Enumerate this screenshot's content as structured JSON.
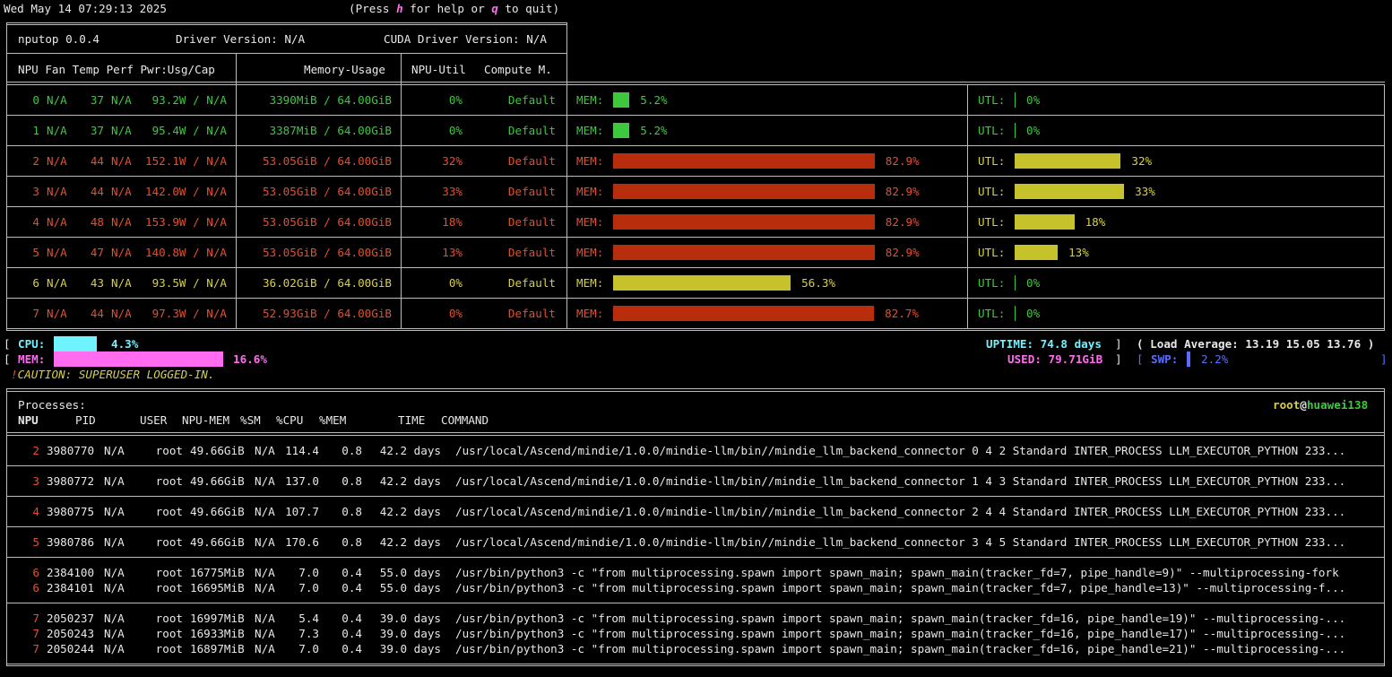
{
  "topbar": {
    "datetime": "Wed May 14 07:29:13 2025",
    "help_prefix": "(Press ",
    "help_key": "h",
    "help_mid": " for help or ",
    "quit_key": "q",
    "help_suffix": " to quit)"
  },
  "header": {
    "app": "nputop 0.0.4",
    "driver": "Driver Version: N/A",
    "cuda": "CUDA Driver Version: N/A",
    "col_left": "NPU Fan Temp Perf Pwr:Usg/Cap",
    "col_mem": "Memory-Usage",
    "col_util": "NPU-Util",
    "col_compute": "Compute M."
  },
  "npus": [
    {
      "id": "0",
      "fan": "N/A",
      "temp": "37",
      "perf": "N/A",
      "pwr": "93.2W / N/A",
      "mem": "3390MiB / 64.00GiB",
      "util": "0%",
      "compute": "Default",
      "mem_pct": 5.2,
      "mem_label": "5.2%",
      "util_pct": 0,
      "util_label": "0%",
      "color": "g",
      "mem_bar_color": "#3ec83e",
      "util_bar_color": "#3ec83e"
    },
    {
      "id": "1",
      "fan": "N/A",
      "temp": "37",
      "perf": "N/A",
      "pwr": "95.4W / N/A",
      "mem": "3387MiB / 64.00GiB",
      "util": "0%",
      "compute": "Default",
      "mem_pct": 5.2,
      "mem_label": "5.2%",
      "util_pct": 0,
      "util_label": "0%",
      "color": "g",
      "mem_bar_color": "#3ec83e",
      "util_bar_color": "#3ec83e"
    },
    {
      "id": "2",
      "fan": "N/A",
      "temp": "44",
      "perf": "N/A",
      "pwr": "152.1W / N/A",
      "mem": "53.05GiB / 64.00GiB",
      "util": "32%",
      "compute": "Default",
      "mem_pct": 82.9,
      "mem_label": "82.9%",
      "util_pct": 32,
      "util_label": "32%",
      "color": "r",
      "mem_bar_color": "#b82d0c",
      "util_bar_color": "#c6c22c"
    },
    {
      "id": "3",
      "fan": "N/A",
      "temp": "44",
      "perf": "N/A",
      "pwr": "142.0W / N/A",
      "mem": "53.05GiB / 64.00GiB",
      "util": "33%",
      "compute": "Default",
      "mem_pct": 82.9,
      "mem_label": "82.9%",
      "util_pct": 33,
      "util_label": "33%",
      "color": "r",
      "mem_bar_color": "#b82d0c",
      "util_bar_color": "#c6c22c"
    },
    {
      "id": "4",
      "fan": "N/A",
      "temp": "48",
      "perf": "N/A",
      "pwr": "153.9W / N/A",
      "mem": "53.05GiB / 64.00GiB",
      "util": "18%",
      "compute": "Default",
      "mem_pct": 82.9,
      "mem_label": "82.9%",
      "util_pct": 18,
      "util_label": "18%",
      "color": "r",
      "mem_bar_color": "#b82d0c",
      "util_bar_color": "#c6c22c"
    },
    {
      "id": "5",
      "fan": "N/A",
      "temp": "47",
      "perf": "N/A",
      "pwr": "140.8W / N/A",
      "mem": "53.05GiB / 64.00GiB",
      "util": "13%",
      "compute": "Default",
      "mem_pct": 82.9,
      "mem_label": "82.9%",
      "util_pct": 13,
      "util_label": "13%",
      "color": "r",
      "mem_bar_color": "#b82d0c",
      "util_bar_color": "#c6c22c"
    },
    {
      "id": "6",
      "fan": "N/A",
      "temp": "43",
      "perf": "N/A",
      "pwr": "93.5W / N/A",
      "mem": "36.02GiB / 64.00GiB",
      "util": "0%",
      "compute": "Default",
      "mem_pct": 56.3,
      "mem_label": "56.3%",
      "util_pct": 0,
      "util_label": "0%",
      "color": "y",
      "mem_bar_color": "#c6c22c",
      "util_bar_color": "#3ec83e"
    },
    {
      "id": "7",
      "fan": "N/A",
      "temp": "44",
      "perf": "N/A",
      "pwr": "97.3W / N/A",
      "mem": "52.93GiB / 64.00GiB",
      "util": "0%",
      "compute": "Default",
      "mem_pct": 82.7,
      "mem_label": "82.7%",
      "util_pct": 0,
      "util_label": "0%",
      "color": "r",
      "mem_bar_color": "#b82d0c",
      "util_bar_color": "#3ec83e"
    }
  ],
  "labels": {
    "mem": "MEM:",
    "utl": "UTL:"
  },
  "system": {
    "cpu_label": "CPU:",
    "cpu_pct": 4.3,
    "cpu_value": "4.3%",
    "mem_label": "MEM:",
    "mem_pct": 16.6,
    "mem_value": "16.6%",
    "uptime": "UPTIME: 74.8 days",
    "load": "( Load Average: 13.19 15.05 13.76 )",
    "used": "USED: 79.71GiB",
    "swp_label": "SWP:",
    "swp_pct": 2.2,
    "swp_value": "2.2%",
    "caution": "CAUTION: SUPERUSER LOGGED-IN."
  },
  "processes": {
    "title": "Processes:",
    "user": "root",
    "host": "huawei138",
    "columns": {
      "npu": "NPU",
      "pid": "PID",
      "user": "USER",
      "npumem": "NPU-MEM",
      "sm": "%SM",
      "cpu": "%CPU",
      "mem": "%MEM",
      "time": "TIME",
      "command": "COMMAND"
    },
    "rows": [
      {
        "npu": "2",
        "pid": "3980770",
        "x": "N/A",
        "user": "root",
        "npumem": "49.66GiB",
        "sm": "N/A",
        "cpu": "114.4",
        "mem": "0.8",
        "time": "42.2 days",
        "command": "/usr/local/Ascend/mindie/1.0.0/mindie-llm/bin//mindie_llm_backend_connector 0 4 2 Standard INTER_PROCESS LLM_EXECUTOR_PYTHON 233..."
      },
      {
        "npu": "3",
        "pid": "3980772",
        "x": "N/A",
        "user": "root",
        "npumem": "49.66GiB",
        "sm": "N/A",
        "cpu": "137.0",
        "mem": "0.8",
        "time": "42.2 days",
        "command": "/usr/local/Ascend/mindie/1.0.0/mindie-llm/bin//mindie_llm_backend_connector 1 4 3 Standard INTER_PROCESS LLM_EXECUTOR_PYTHON 233..."
      },
      {
        "npu": "4",
        "pid": "3980775",
        "x": "N/A",
        "user": "root",
        "npumem": "49.66GiB",
        "sm": "N/A",
        "cpu": "107.7",
        "mem": "0.8",
        "time": "42.2 days",
        "command": "/usr/local/Ascend/mindie/1.0.0/mindie-llm/bin//mindie_llm_backend_connector 2 4 4 Standard INTER_PROCESS LLM_EXECUTOR_PYTHON 233..."
      },
      {
        "npu": "5",
        "pid": "3980786",
        "x": "N/A",
        "user": "root",
        "npumem": "49.66GiB",
        "sm": "N/A",
        "cpu": "170.6",
        "mem": "0.8",
        "time": "42.2 days",
        "command": "/usr/local/Ascend/mindie/1.0.0/mindie-llm/bin//mindie_llm_backend_connector 3 4 5 Standard INTER_PROCESS LLM_EXECUTOR_PYTHON 233..."
      },
      {
        "npu": "6",
        "pid": "2384100",
        "x": "N/A",
        "user": "root",
        "npumem": "16775MiB",
        "sm": "N/A",
        "cpu": "7.0",
        "mem": "0.4",
        "time": "55.0 days",
        "command": "/usr/bin/python3 -c \"from multiprocessing.spawn import spawn_main; spawn_main(tracker_fd=7, pipe_handle=9)\" --multiprocessing-fork"
      },
      {
        "npu": "6",
        "pid": "2384101",
        "x": "N/A",
        "user": "root",
        "npumem": "16695MiB",
        "sm": "N/A",
        "cpu": "7.0",
        "mem": "0.4",
        "time": "55.0 days",
        "command": "/usr/bin/python3 -c \"from multiprocessing.spawn import spawn_main; spawn_main(tracker_fd=7, pipe_handle=13)\" --multiprocessing-f..."
      },
      {
        "npu": "7",
        "pid": "2050237",
        "x": "N/A",
        "user": "root",
        "npumem": "16997MiB",
        "sm": "N/A",
        "cpu": "5.4",
        "mem": "0.4",
        "time": "39.0 days",
        "command": "/usr/bin/python3 -c \"from multiprocessing.spawn import spawn_main; spawn_main(tracker_fd=16, pipe_handle=19)\" --multiprocessing-..."
      },
      {
        "npu": "7",
        "pid": "2050243",
        "x": "N/A",
        "user": "root",
        "npumem": "16933MiB",
        "sm": "N/A",
        "cpu": "7.3",
        "mem": "0.4",
        "time": "39.0 days",
        "command": "/usr/bin/python3 -c \"from multiprocessing.spawn import spawn_main; spawn_main(tracker_fd=16, pipe_handle=17)\" --multiprocessing-..."
      },
      {
        "npu": "7",
        "pid": "2050244",
        "x": "N/A",
        "user": "root",
        "npumem": "16897MiB",
        "sm": "N/A",
        "cpu": "7.0",
        "mem": "0.4",
        "time": "39.0 days",
        "command": "/usr/bin/python3 -c \"from multiprocessing.spawn import spawn_main; spawn_main(tracker_fd=16, pipe_handle=21)\" --multiprocessing-..."
      }
    ]
  }
}
